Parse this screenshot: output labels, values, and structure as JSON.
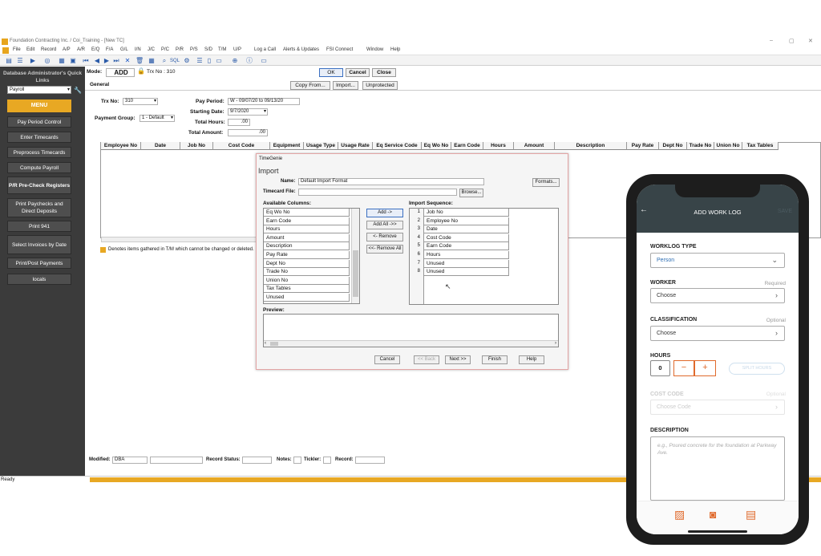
{
  "window": {
    "title": "Foundation Contracting Inc. / Coi_Training - [New TC]",
    "controls": [
      "–",
      "▢",
      "✕"
    ]
  },
  "menubar": [
    "File",
    "Edit",
    "Record",
    "A/P",
    "A/R",
    "E/Q",
    "F/A",
    "G/L",
    "I/N",
    "J/C",
    "P/C",
    "P/R",
    "P/S",
    "S/D",
    "T/M",
    "U/P",
    "Log a Call",
    "Alerts & Updates",
    "FSI Connect",
    "Window",
    "Help"
  ],
  "sidebar": {
    "header": "Database Administrator's Quick Links",
    "select_value": "Payroll",
    "menu_label": "MENU",
    "items": [
      "Pay Period Control",
      "Enter Timecards",
      "Preprocess Timecards",
      "Compute Payroll",
      "P/R Pre-Check Registers",
      "Print Paychecks and Direct Deposits",
      "Print 941",
      "Select Invoices by Date",
      "Print/Post Payments",
      "locals"
    ]
  },
  "form": {
    "mode_label": "Mode:",
    "mode_value": "ADD",
    "trx_header": "Trx No : 310",
    "ok": "OK",
    "cancel": "Cancel",
    "close": "Close",
    "tab_general": "General",
    "copy_from": "Copy From...",
    "import": "Import...",
    "unprotected": "Unprotected",
    "trx_no_label": "Trx No:",
    "trx_no_value": "310",
    "pay_period_label": "Pay Period:",
    "pay_period_value": "W - 09/07/20 to 09/13/20",
    "payment_group_label": "Payment Group:",
    "payment_group_value": "1 - Default",
    "starting_date_label": "Starting Date:",
    "starting_date_value": "9/7/2020",
    "total_hours_label": "Total Hours:",
    "total_hours_value": ".00",
    "total_amount_label": "Total Amount:",
    "total_amount_value": ".00",
    "grid_headers": [
      "Employee No",
      "Date",
      "Job No",
      "Cost Code",
      "Equipment",
      "Usage Type",
      "Usage Rate",
      "Eq Service Code",
      "Eq Wo No",
      "Earn Code",
      "Hours",
      "Amount",
      "Description",
      "Pay Rate",
      "Dept No",
      "Trade No",
      "Union No",
      "Tax Tables"
    ],
    "legend_note": "Denotes items gathered in T/M which cannot be changed or deleted.",
    "footer": {
      "modified_label": "Modified:",
      "modified_value": "DBA",
      "record_status_label": "Record Status:",
      "notes_label": "Notes:",
      "tickler_label": "Tickler:",
      "record_label": "Record:"
    }
  },
  "status": {
    "text": "Ready"
  },
  "dialog": {
    "app": "TimeGenie",
    "title": "Import",
    "name_label": "Name:",
    "name_value": "Default Import Format",
    "formats_btn": "Formats...",
    "timecard_file_label": "Timecard File:",
    "browse_btn": "Browse...",
    "available_label": "Available Columns:",
    "available": [
      "Eq Wo No",
      "Earn Code",
      "Hours",
      "Amount",
      "Description",
      "Pay Rate",
      "Dept No",
      "Trade No",
      "Union No",
      "Tax Tables",
      "Unused"
    ],
    "add_btn": "Add ->",
    "add_all_btn": "Add All ->>",
    "remove_btn": "<- Remove",
    "remove_all_btn": "<<- Remove All",
    "sequence_label": "Import Sequence:",
    "sequence": [
      {
        "n": "1",
        "name": "Job No"
      },
      {
        "n": "2",
        "name": "Employee No"
      },
      {
        "n": "3",
        "name": "Date"
      },
      {
        "n": "4",
        "name": "Cost Code"
      },
      {
        "n": "5",
        "name": "Earn Code"
      },
      {
        "n": "6",
        "name": "Hours"
      },
      {
        "n": "7",
        "name": "Unused"
      },
      {
        "n": "8",
        "name": "Unused"
      }
    ],
    "preview_label": "Preview:",
    "cancel_btn": "Cancel",
    "back_btn": "<< Back",
    "next_btn": "Next >>",
    "finish_btn": "Finish",
    "help_btn": "Help"
  },
  "phone": {
    "header_title": "ADD WORK LOG",
    "save": "SAVE",
    "worklog_type_label": "WORKLOG TYPE",
    "worklog_type_value": "Person",
    "worker_label": "WORKER",
    "worker_required": "Required",
    "worker_value": "Choose",
    "classification_label": "CLASSIFICATION",
    "classification_optional": "Optional",
    "classification_value": "Choose",
    "hours_label": "HOURS",
    "hours_value": "0",
    "minus": "−",
    "plus": "+",
    "split_hours": "SPLIT HOURS",
    "cost_code_label": "COST CODE",
    "cost_code_optional": "Optional",
    "cost_code_value": "Choose Code",
    "description_label": "DESCRIPTION",
    "description_placeholder": "e.g., Poured concrete for the foundation at Parkway Ave.",
    "accent": "#e06a2c"
  }
}
